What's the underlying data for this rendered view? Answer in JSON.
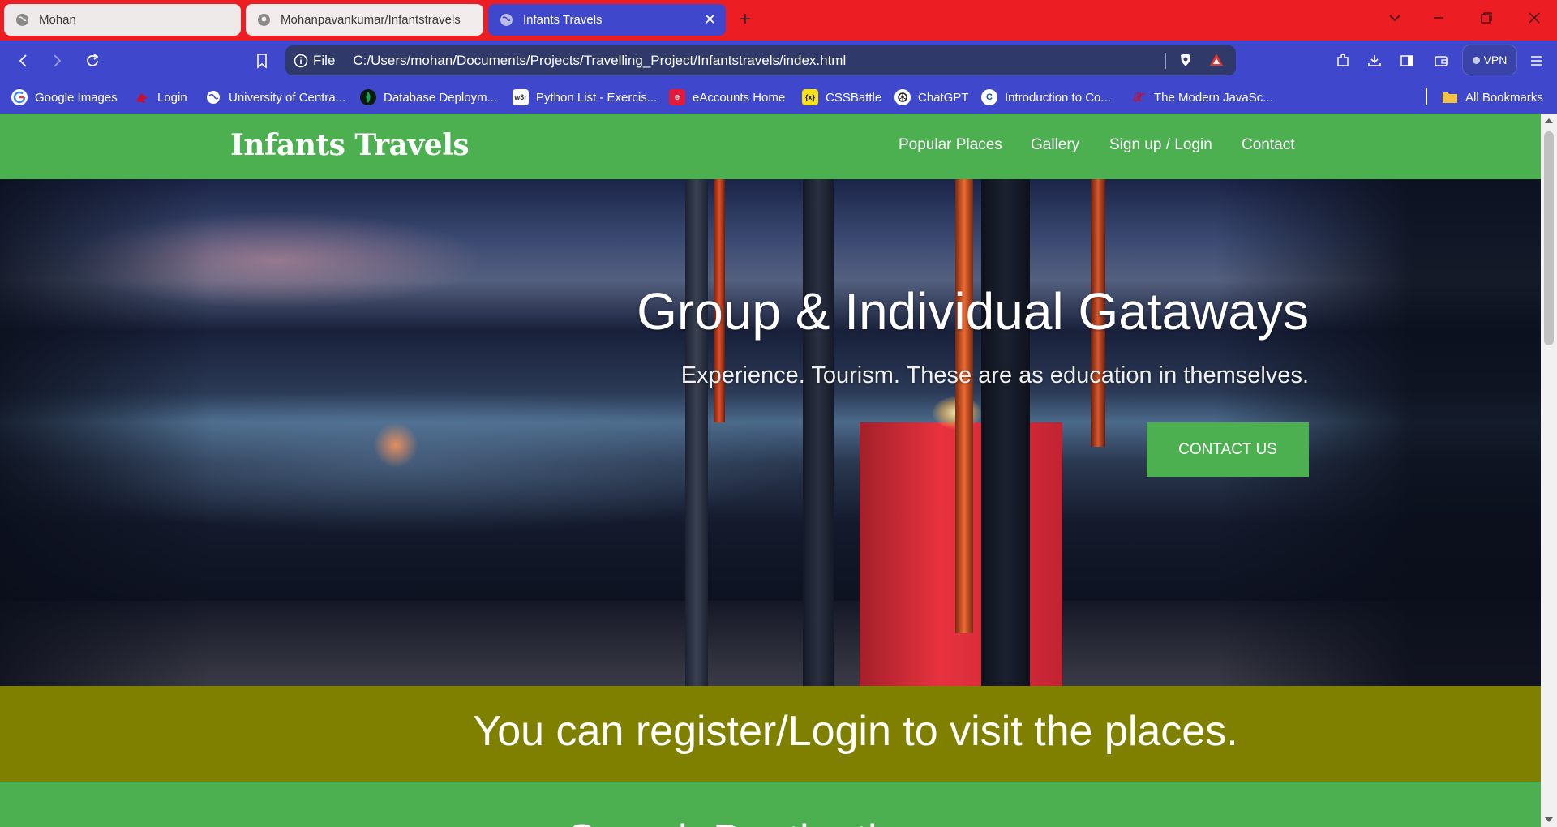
{
  "browser": {
    "tabs": [
      {
        "title": "Mohan",
        "active": false
      },
      {
        "title": "Mohanpavankumar/Infantstravels",
        "active": false
      },
      {
        "title": "Infants Travels",
        "active": true
      }
    ],
    "address": {
      "scheme": "File",
      "url": "C:/Users/mohan/Documents/Projects/Travelling_Project/Infantstravels/index.html"
    },
    "vpn_label": "VPN",
    "bookmarks": [
      {
        "label": "Google Images",
        "icon": "google-icon"
      },
      {
        "label": "Login",
        "icon": "login-bird-icon"
      },
      {
        "label": "University of Centra...",
        "icon": "globe-icon"
      },
      {
        "label": "Database Deploym...",
        "icon": "mongodb-leaf-icon"
      },
      {
        "label": "Python List - Exercis...",
        "icon": "w3resource-icon"
      },
      {
        "label": "eAccounts Home",
        "icon": "eaccounts-icon"
      },
      {
        "label": "CSSBattle",
        "icon": "cssbattle-icon"
      },
      {
        "label": "ChatGPT",
        "icon": "openai-icon"
      },
      {
        "label": "Introduction to Co...",
        "icon": "coursera-icon"
      },
      {
        "label": "The Modern JavaSc...",
        "icon": "javascript-info-icon"
      }
    ],
    "all_bookmarks_label": "All Bookmarks",
    "colors": {
      "tabstrip": "#ec1e24",
      "toolbar": "#3f48cc",
      "active_tab": "#3f48cc"
    }
  },
  "site": {
    "logo": "Infants Travels",
    "nav": [
      "Popular Places",
      "Gallery",
      "Sign up / Login",
      "Contact"
    ],
    "hero": {
      "title": "Group & Individual Gataways",
      "subtitle": "Experience. Tourism. These are as education in themselves.",
      "cta": "CONTACT US"
    },
    "banner": "You can register/Login to visit the places.",
    "next_section_heading": "Search Destination",
    "colors": {
      "nav": "#4caf50",
      "banner": "#808000",
      "cta": "#4caf50"
    }
  }
}
